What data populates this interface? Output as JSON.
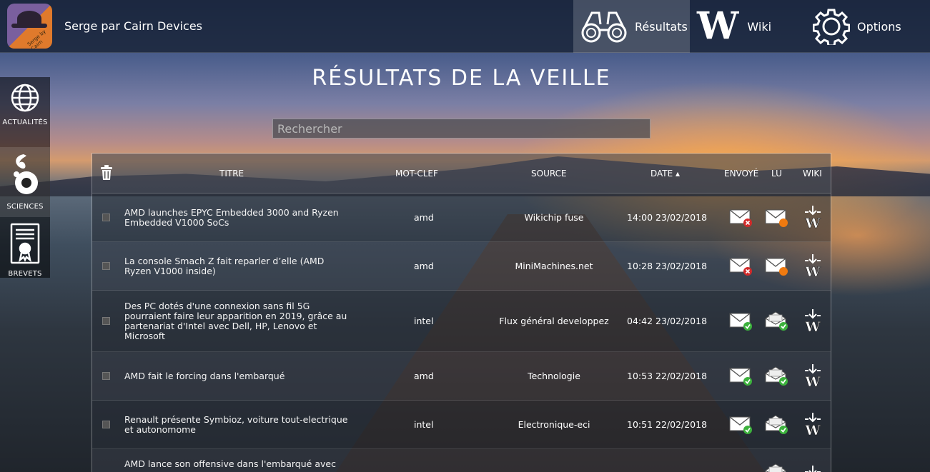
{
  "app": {
    "title": "Serge par Cairn Devices",
    "logo_text": "Serge by Cairn"
  },
  "nav": {
    "tabs": [
      {
        "label": "Résultats",
        "icon": "binoculars-icon",
        "active": true
      },
      {
        "label": "Wiki",
        "icon": "wikipedia-w-icon",
        "active": false
      },
      {
        "label": "Options",
        "icon": "gear-icon",
        "active": false
      }
    ]
  },
  "sidebar": {
    "items": [
      {
        "label": "ACTUALITÉS",
        "icon": "globe-icon"
      },
      {
        "label": "SCIENCES",
        "icon": "sciences-icon"
      },
      {
        "label": "BREVETS",
        "icon": "patent-certificate-icon"
      }
    ]
  },
  "page": {
    "title": "RÉSULTATS DE LA VEILLE",
    "search_placeholder": "Rechercher"
  },
  "table": {
    "headers": {
      "title": "TITRE",
      "keyword": "MOT-CLEF",
      "source": "SOURCE",
      "date": "DATE ▴",
      "sent": "ENVOYÉ",
      "read": "LU",
      "wiki": "WIKI"
    },
    "rows": [
      {
        "title": "AMD launches EPYC Embedded 3000 and Ryzen Embedded V1000 SoCs",
        "keyword": "amd",
        "source": "Wikichip fuse",
        "date": "14:00 23/02/2018",
        "sent": "no",
        "read": "pending"
      },
      {
        "title": "La console Smach Z fait reparler d’elle (AMD Ryzen V1000 inside)",
        "keyword": "amd",
        "source": "MiniMachines.net",
        "date": "10:28 23/02/2018",
        "sent": "no",
        "read": "pending"
      },
      {
        "title": "Des PC dotés d'une connexion sans fil 5G pourraient faire leur apparition en 2019, grâce au partenariat d'Intel avec Dell, HP, Lenovo et Microsoft",
        "keyword": "intel",
        "source": "Flux général developpez",
        "date": "04:42 23/02/2018",
        "sent": "yes",
        "read": "yes"
      },
      {
        "title": "AMD fait le forcing dans l'embarqué",
        "keyword": "amd",
        "source": "Technologie",
        "date": "10:53 22/02/2018",
        "sent": "yes",
        "read": "yes"
      },
      {
        "title": "Renault présente Symbioz, voiture tout-electrique et autonomome",
        "keyword": "intel",
        "source": "Electronique-eci",
        "date": "10:51 22/02/2018",
        "sent": "yes",
        "read": "yes"
      },
      {
        "title": "AMD lance son offensive dans l'embarqué avec ses",
        "keyword": "",
        "source": "",
        "date": "",
        "sent": "",
        "read": "yes"
      }
    ]
  },
  "colors": {
    "header_bg": "#19233a",
    "status_no": "#d22a2a",
    "status_pending": "#f07a10",
    "status_yes": "#3cb23c"
  }
}
